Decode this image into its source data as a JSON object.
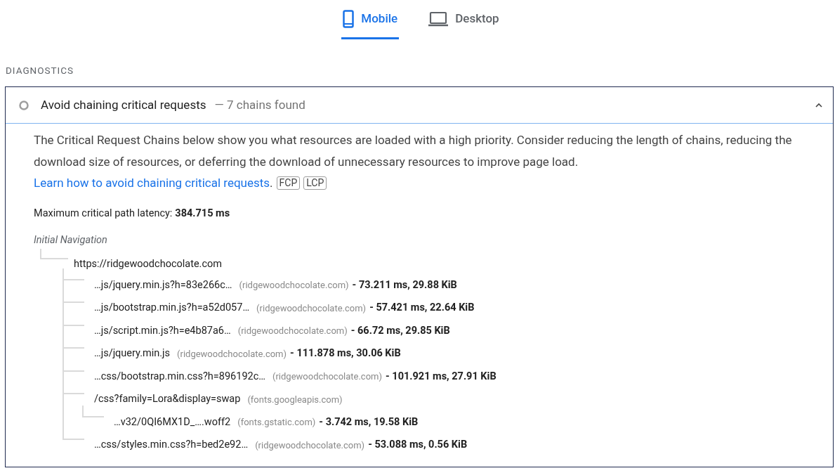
{
  "tabs": [
    {
      "label": "Mobile",
      "selected": true
    },
    {
      "label": "Desktop",
      "selected": false
    }
  ],
  "section_title": "DIAGNOSTICS",
  "audit": {
    "title": "Avoid chaining critical requests",
    "display_value": "— 7 chains found",
    "expanded": true,
    "description": "The Critical Request Chains below show you what resources are loaded with a high priority. Consider reducing the length of chains, reducing the download size of resources, or deferring the download of unnecessary resources to improve page load.",
    "link": "Learn how to avoid chaining critical requests",
    "link_end": ".",
    "tags": [
      "FCP",
      "LCP"
    ],
    "latency_label": "Maximum critical path latency:",
    "latency_value": "384.715 ms",
    "tree_title": "Initial Navigation",
    "tree": [
      {
        "url": "https://ridgewoodchocolate.com",
        "children": [
          {
            "url": "…js/jquery.min.js?h=83e266c…",
            "host": "(ridgewoodchocolate.com)",
            "stats": "- 73.211 ms, 29.88 KiB"
          },
          {
            "url": "…js/bootstrap.min.js?h=a52d057…",
            "host": "(ridgewoodchocolate.com)",
            "stats": "- 57.421 ms, 22.64 KiB"
          },
          {
            "url": "…js/script.min.js?h=e4b87a6…",
            "host": "(ridgewoodchocolate.com)",
            "stats": "- 66.72 ms, 29.85 KiB"
          },
          {
            "url": "…js/jquery.min.js",
            "host": "(ridgewoodchocolate.com)",
            "stats": "- 111.878 ms, 30.06 KiB"
          },
          {
            "url": "…css/bootstrap.min.css?h=896192c…",
            "host": "(ridgewoodchocolate.com)",
            "stats": "- 101.921 ms, 27.91 KiB"
          },
          {
            "url": "/css?family=Lora&display=swap",
            "host": "(fonts.googleapis.com)",
            "children": [
              {
                "url": "…v32/0QI6MX1D_….woff2",
                "host": "(fonts.gstatic.com)",
                "stats": "- 3.742 ms, 19.58 KiB"
              }
            ]
          },
          {
            "url": "…css/styles.min.css?h=bed2e92…",
            "host": "(ridgewoodchocolate.com)",
            "stats": "- 53.088 ms, 0.56 KiB"
          }
        ]
      }
    ]
  }
}
